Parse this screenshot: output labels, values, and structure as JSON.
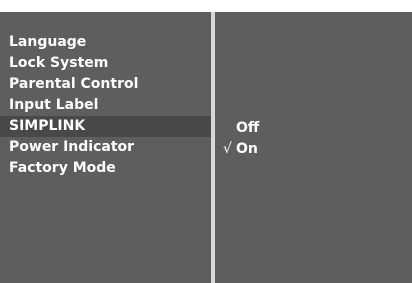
{
  "menu": {
    "items": [
      {
        "label": "Language"
      },
      {
        "label": "Lock System"
      },
      {
        "label": "Parental Control"
      },
      {
        "label": "Input Label"
      },
      {
        "label": "SIMPLINK",
        "selected": true
      },
      {
        "label": "Power Indicator"
      },
      {
        "label": "Factory Mode"
      }
    ]
  },
  "submenu": {
    "options": [
      {
        "label": "Off",
        "checked": false
      },
      {
        "label": "On",
        "checked": true
      }
    ],
    "check_mark": "√"
  },
  "colors": {
    "panel_bg": "#5e5e5e",
    "selected_bg": "#484848",
    "divider": "#d7d7d7",
    "text": "#ffffff"
  }
}
